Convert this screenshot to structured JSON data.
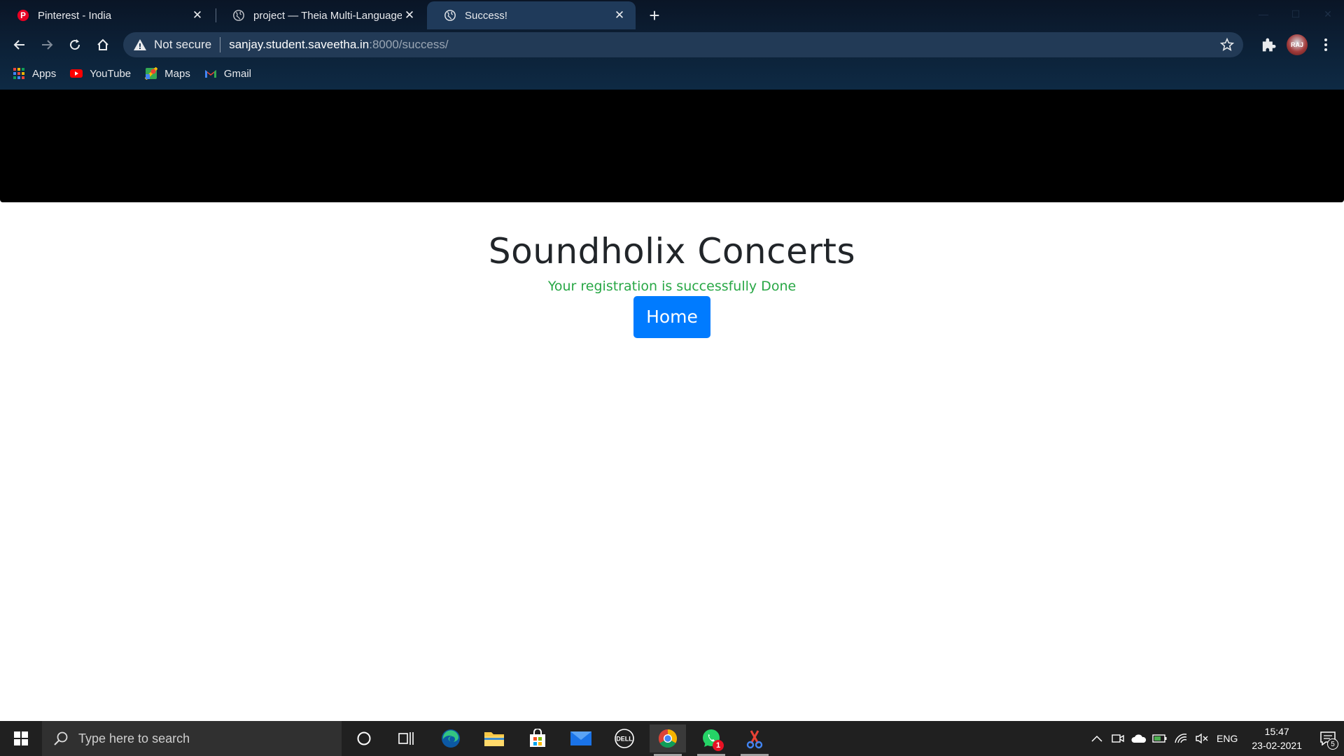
{
  "browser": {
    "tabs": [
      {
        "title": "Pinterest - India",
        "icon": "pinterest-icon",
        "active": false
      },
      {
        "title": "project — Theia Multi-Language",
        "icon": "globe-icon",
        "active": false
      },
      {
        "title": "Success!",
        "icon": "globe-icon",
        "active": true
      }
    ],
    "address": {
      "security_label": "Not secure",
      "host": "sanjay.student.saveetha.in",
      "path": ":8000/success/"
    },
    "avatar_text": "RAJ",
    "bookmarks": [
      {
        "label": "Apps",
        "icon": "apps-grid-icon"
      },
      {
        "label": "YouTube",
        "icon": "youtube-icon"
      },
      {
        "label": "Maps",
        "icon": "maps-icon"
      },
      {
        "label": "Gmail",
        "icon": "gmail-icon"
      }
    ]
  },
  "page": {
    "title": "Soundholix Concerts",
    "message": "Your registration is successfully Done",
    "home_button": "Home",
    "colors": {
      "title": "#212529",
      "message": "#28a745",
      "button": "#007bff",
      "band": "#000000"
    }
  },
  "taskbar": {
    "search_placeholder": "Type here to search",
    "apps": [
      "cortana-icon",
      "task-view-icon",
      "edge-icon",
      "file-explorer-icon",
      "store-icon",
      "mail-icon",
      "dell-icon",
      "chrome-icon",
      "whatsapp-icon",
      "snipping-tool-icon"
    ],
    "whatsapp_badge": "1",
    "language": "ENG",
    "time": "15:47",
    "date": "23-02-2021",
    "notification_count": "5"
  }
}
